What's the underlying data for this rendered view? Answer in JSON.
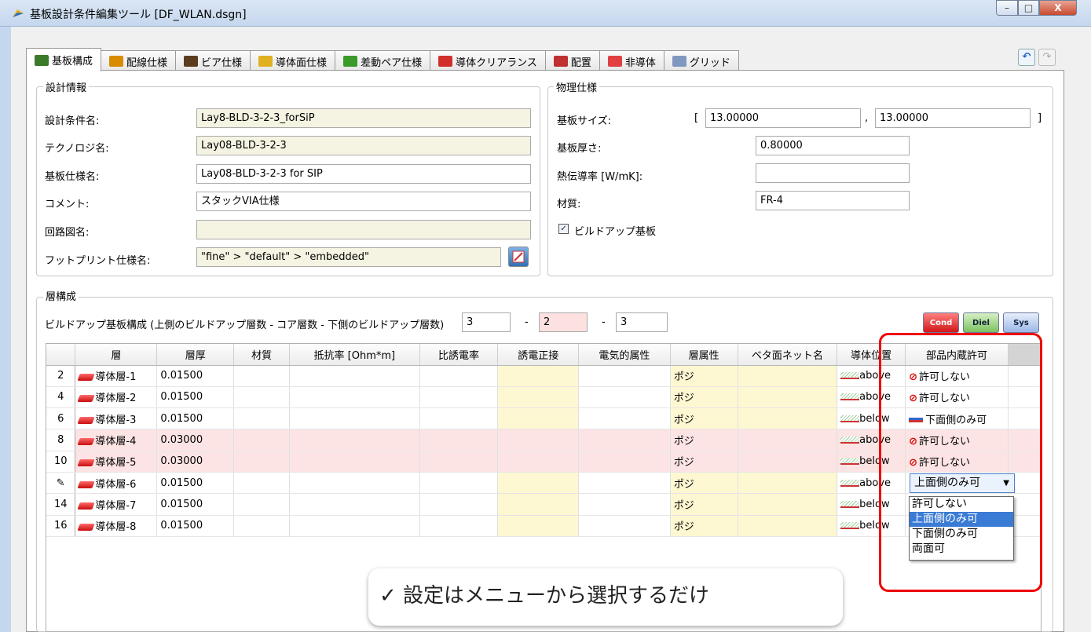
{
  "window": {
    "title": "基板設計条件編集ツール [DF_WLAN.dsgn]",
    "buttons": {
      "minimize": "–",
      "maximize": "□",
      "close": "X"
    }
  },
  "tabs": [
    {
      "label": "基板構成",
      "icon": "layers-icon",
      "color": "#3a7a2a"
    },
    {
      "label": "配線仕様",
      "icon": "wiring-icon",
      "color": "#d98b00"
    },
    {
      "label": "ビア仕様",
      "icon": "via-icon",
      "color": "#5b3c1e"
    },
    {
      "label": "導体面仕様",
      "icon": "plane-icon",
      "color": "#e0b020"
    },
    {
      "label": "差動ペア仕様",
      "icon": "diffpair-icon",
      "color": "#3a9a2a"
    },
    {
      "label": "導体クリアランス",
      "icon": "clearance-icon",
      "color": "#d0302a"
    },
    {
      "label": "配置",
      "icon": "placement-icon",
      "color": "#c03030"
    },
    {
      "label": "非導体",
      "icon": "nonconductor-icon",
      "color": "#e04040"
    },
    {
      "label": "グリッド",
      "icon": "grid-icon",
      "color": "#8098c0"
    }
  ],
  "toolbar": {
    "undo": "↶",
    "redo": "↷"
  },
  "design_info": {
    "title": "設計情報",
    "rows": [
      {
        "label": "設計条件名:",
        "value": "Lay8-BLD-3-2-3_forSiP"
      },
      {
        "label": "テクノロジ名:",
        "value": "Lay08-BLD-3-2-3"
      },
      {
        "label": "基板仕様名:",
        "value": "Lay08-BLD-3-2-3 for SIP"
      },
      {
        "label": "コメント:",
        "value": "スタックVIA仕様"
      },
      {
        "label": "回路図名:",
        "value": ""
      },
      {
        "label": "フットプリント仕様名:",
        "value": "\"fine\" > \"default\" > \"embedded\""
      }
    ]
  },
  "physical": {
    "title": "物理仕様",
    "size_label": "基板サイズ:",
    "size_open": "[",
    "size_x": "13.00000",
    "size_comma": ",",
    "size_y": "13.00000",
    "size_close": "]",
    "thickness_label": "基板厚さ:",
    "thickness": "0.80000",
    "conductivity_label": "熱伝導率 [W/mK]:",
    "conductivity": "",
    "material_label": "材質:",
    "material": "FR-4",
    "buildup_label": "ビルドアップ基板",
    "buildup_checked": "✓"
  },
  "layer_config": {
    "title": "層構成",
    "buildup_label": "ビルドアップ基板構成 (上側のビルドアップ層数 - コア層数 - 下側のビルドアップ層数)",
    "upper": "3",
    "dash1": "-",
    "core": "2",
    "dash2": "-",
    "lower": "3",
    "mode_buttons": [
      "Cond",
      "Diel",
      "Sys"
    ]
  },
  "table": {
    "headers": [
      "",
      "層",
      "層厚",
      "材質",
      "抵抗率 [Ohm*m]",
      "比誘電率",
      "誘電正接",
      "電気的属性",
      "層属性",
      "ベタ面ネット名",
      "導体位置",
      "部品内蔵許可"
    ],
    "rows": [
      {
        "num": "2",
        "name": "導体層-1",
        "thick": "0.01500",
        "attr": "ポジ",
        "pos": "above",
        "embed": "許可しない",
        "embed_icon": "no-icon"
      },
      {
        "num": "4",
        "name": "導体層-2",
        "thick": "0.01500",
        "attr": "ポジ",
        "pos": "above",
        "embed": "許可しない",
        "embed_icon": "no-icon"
      },
      {
        "num": "6",
        "name": "導体層-3",
        "thick": "0.01500",
        "attr": "ポジ",
        "pos": "below",
        "embed": "下面側のみ可",
        "embed_icon": "bottom-icon"
      },
      {
        "num": "8",
        "name": "導体層-4",
        "thick": "0.03000",
        "attr": "ポジ",
        "pos": "above",
        "embed": "許可しない",
        "embed_icon": "no-icon"
      },
      {
        "num": "10",
        "name": "導体層-5",
        "thick": "0.03000",
        "attr": "ポジ",
        "pos": "below",
        "embed": "許可しない",
        "embed_icon": "no-icon"
      },
      {
        "num": "✎",
        "name": "導体層-6",
        "thick": "0.01500",
        "attr": "ポジ",
        "pos": "above",
        "embed": "",
        "embed_icon": ""
      },
      {
        "num": "14",
        "name": "導体層-7",
        "thick": "0.01500",
        "attr": "ポジ",
        "pos": "below",
        "embed": "",
        "embed_icon": ""
      },
      {
        "num": "16",
        "name": "導体層-8",
        "thick": "0.01500",
        "attr": "ポジ",
        "pos": "below",
        "embed": "",
        "embed_icon": ""
      }
    ]
  },
  "dropdown": {
    "value": "上面側のみ可",
    "arrow": "▼",
    "options": [
      "許可しない",
      "上面側のみ可",
      "下面側のみ可",
      "両面可"
    ],
    "selected": "上面側のみ可"
  },
  "callout": {
    "text": "✓  設定はメニューから選択するだけ"
  }
}
